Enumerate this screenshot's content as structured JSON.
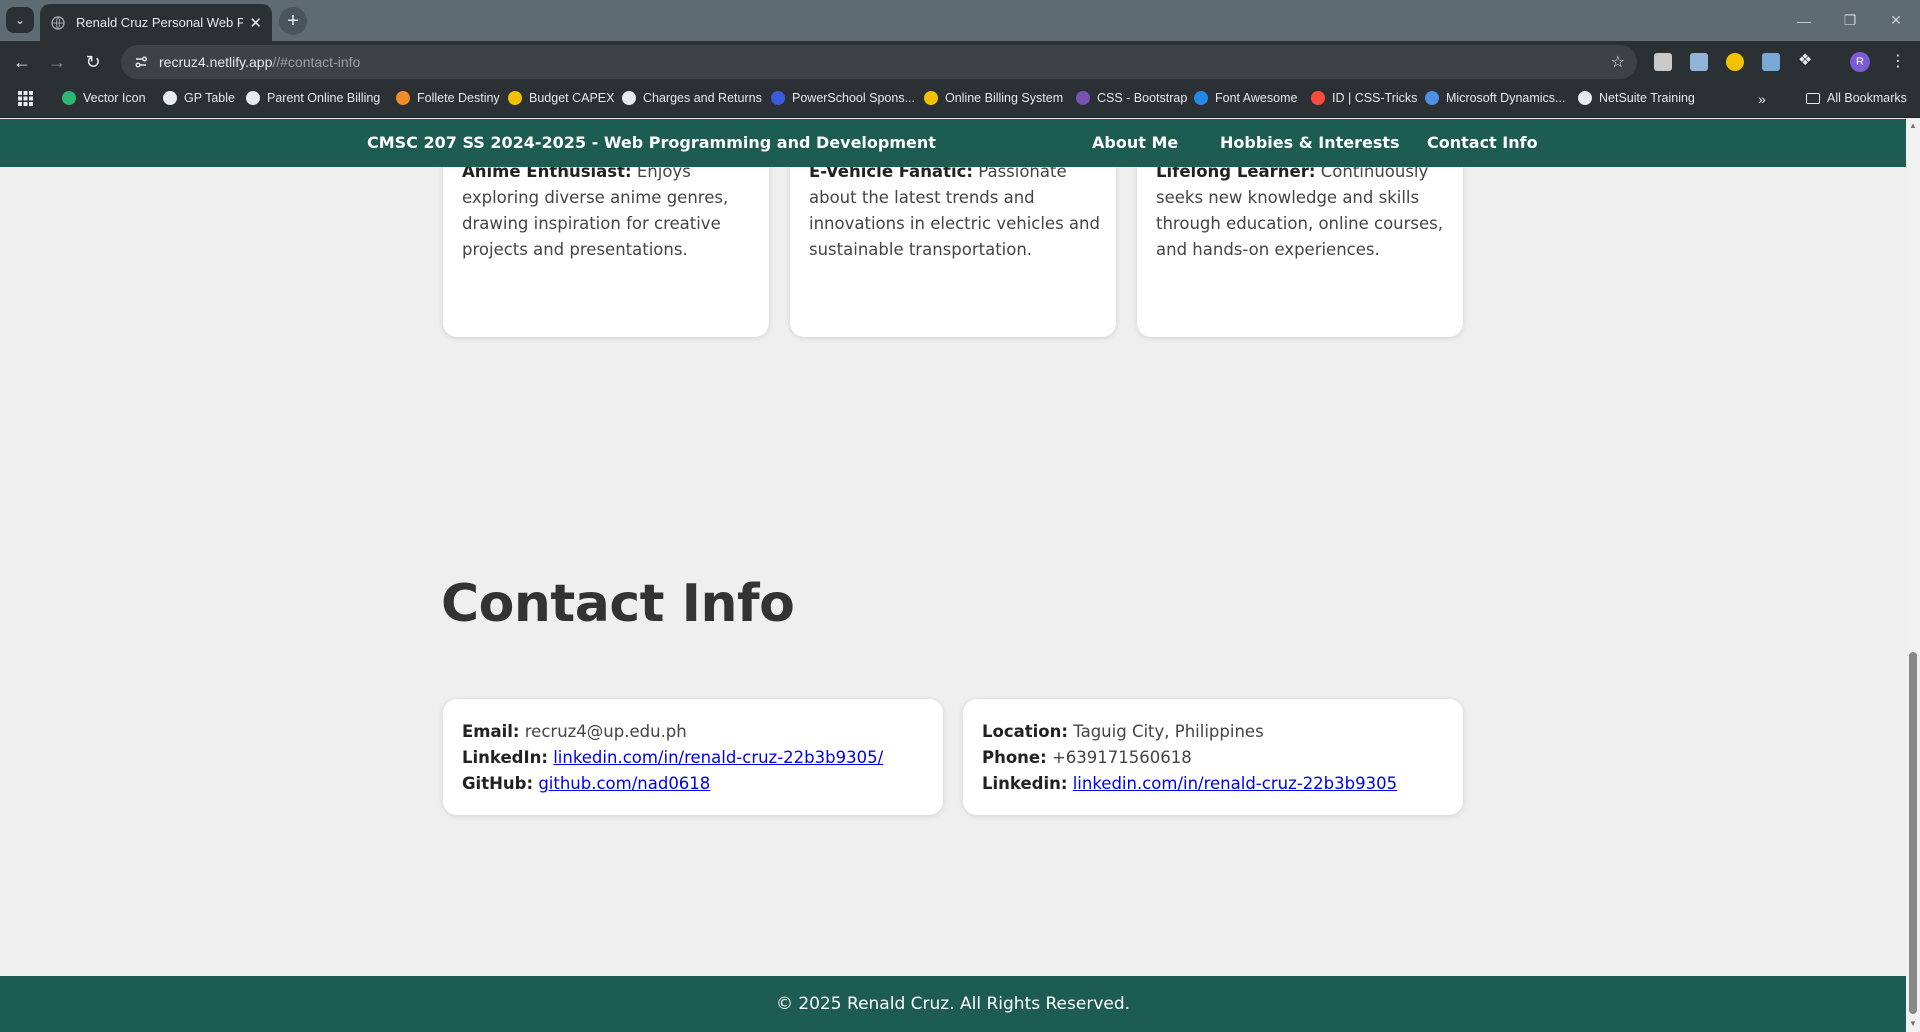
{
  "browser": {
    "tab_title": "Renald Cruz Personal Web Profi",
    "url_host": "recruz4.netlify.app",
    "url_path": "//#contact-info",
    "bookmarks": [
      {
        "label": "Vector Icon",
        "color": "#2bb673"
      },
      {
        "label": "GP Table",
        "color": "#e8eaed"
      },
      {
        "label": "Parent Online Billing",
        "color": "#e8eaed"
      },
      {
        "label": "Follete Destiny",
        "color": "#f28c28"
      },
      {
        "label": "Budget CAPEX",
        "color": "#f2c200"
      },
      {
        "label": "Charges and Returns",
        "color": "#e8eaed"
      },
      {
        "label": "PowerSchool Spons...",
        "color": "#3b5bdb"
      },
      {
        "label": "Online Billing System",
        "color": "#f2c200"
      },
      {
        "label": "CSS - Bootstrap",
        "color": "#7952b3"
      },
      {
        "label": "Font Awesome",
        "color": "#228ae6"
      },
      {
        "label": "ID | CSS-Tricks",
        "color": "#ff4a3d"
      },
      {
        "label": "Microsoft Dynamics...",
        "color": "#4f8fe3"
      },
      {
        "label": "NetSuite Training",
        "color": "#e8eaed"
      }
    ],
    "all_bookmarks": "All Bookmarks",
    "profile_initial": "R"
  },
  "site": {
    "brand": "CMSC 207 SS 2024-2025 - Web Programming and Development",
    "nav": [
      "About Me",
      "Hobbies & Interests",
      "Contact Info"
    ]
  },
  "hobbies": [
    {
      "title": "Anime Enthusiast:",
      "text": " Enjoys exploring diverse anime genres, drawing inspiration for creative projects and presentations."
    },
    {
      "title": "E-Vehicle Fanatic:",
      "text": " Passionate about the latest trends and innovations in electric vehicles and sustainable transportation."
    },
    {
      "title": "Lifelong Learner:",
      "text": " Continuously seeks new knowledge and skills through education, online courses, and hands-on experiences."
    }
  ],
  "contact": {
    "title": "Contact Info",
    "left": {
      "email_label": "Email:",
      "email_value": " recruz4@up.edu.ph",
      "linkedin_label": "LinkedIn:",
      "linkedin_value": "linkedin.com/in/renald-cruz-22b3b9305/",
      "github_label": "GitHub:",
      "github_value": "github.com/nad0618"
    },
    "right": {
      "location_label": "Location:",
      "location_value": " Taguig City, Philippines",
      "phone_label": "Phone:",
      "phone_value": " +639171560618",
      "linkedin_label": "Linkedin:",
      "linkedin_value": "linkedin.com/in/renald-cruz-22b3b9305"
    }
  },
  "footer": "© 2025 Renald Cruz. All Rights Reserved.",
  "colors": {
    "brand": "#1d5c53",
    "page_bg": "#efefef",
    "link": "#0000ee"
  }
}
